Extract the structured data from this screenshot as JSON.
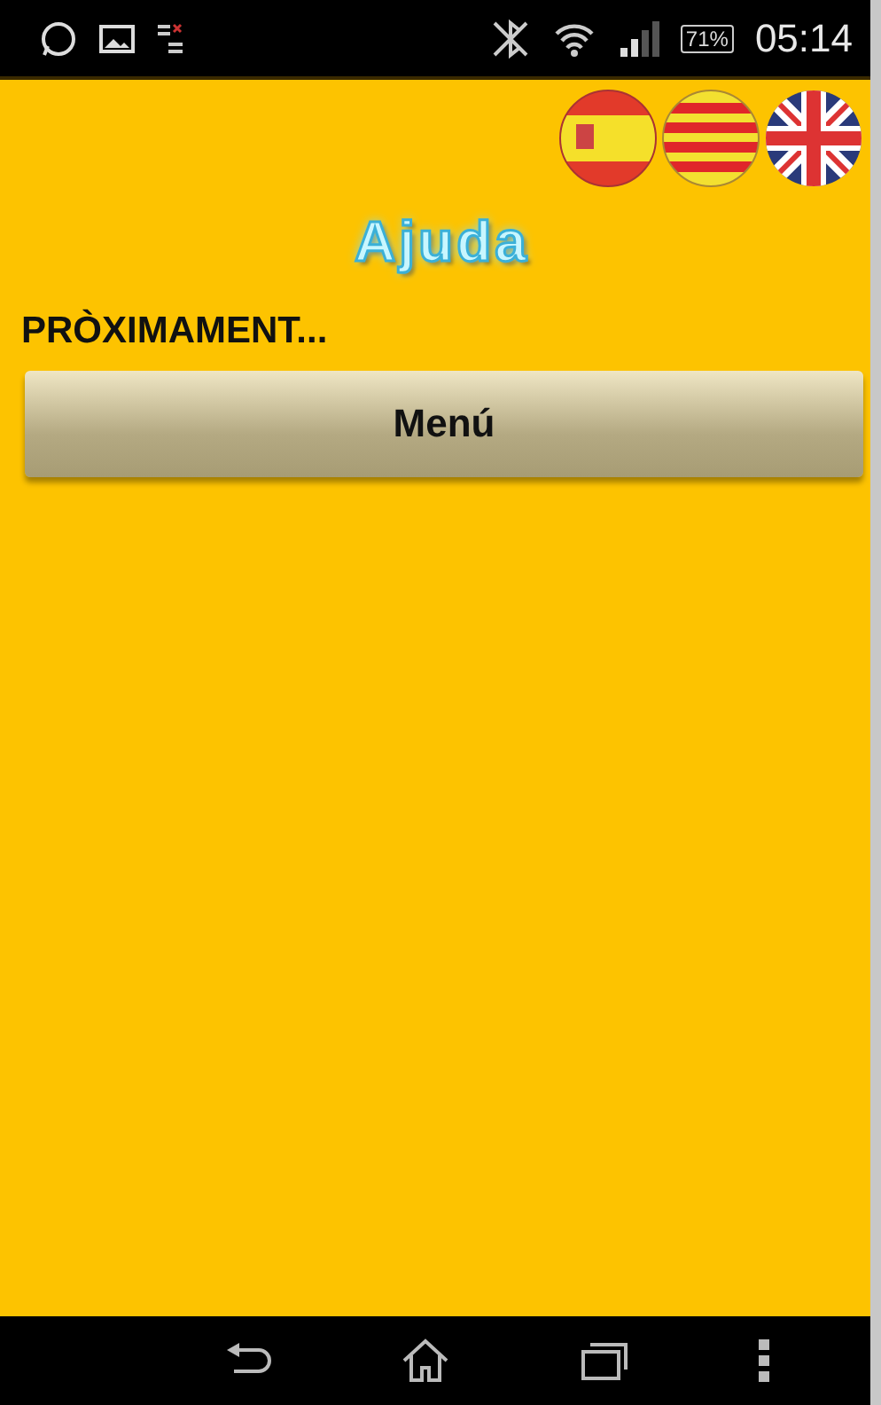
{
  "status_bar": {
    "battery": "71%",
    "time": "05:14"
  },
  "title": "Ajuda",
  "message": "PRÒXIMAMENT...",
  "menu_button": "Menú"
}
